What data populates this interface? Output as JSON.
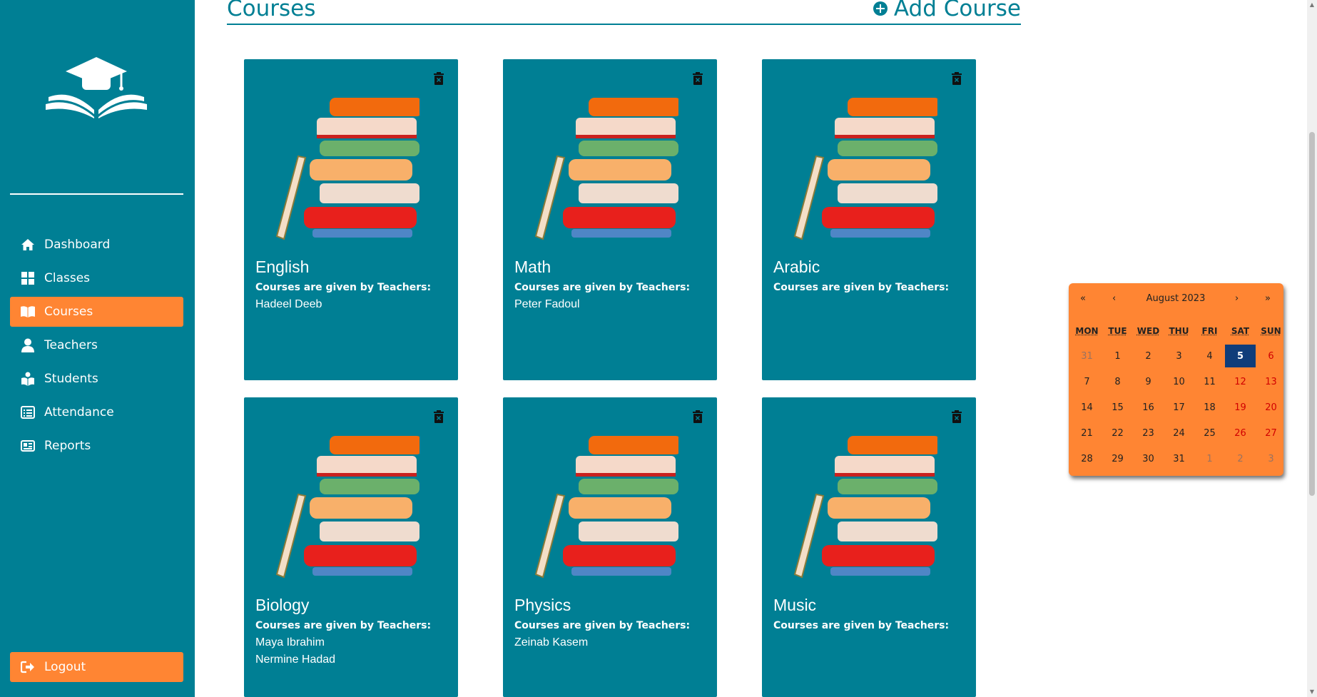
{
  "sidebar": {
    "logo": "graduation-cap-book-logo",
    "items": [
      {
        "label": "Dashboard",
        "icon": "home-icon"
      },
      {
        "label": "Classes",
        "icon": "grid-icon"
      },
      {
        "label": "Courses",
        "icon": "open-book-icon",
        "active": true
      },
      {
        "label": "Teachers",
        "icon": "person-icon"
      },
      {
        "label": "Students",
        "icon": "student-icon"
      },
      {
        "label": "Attendance",
        "icon": "list-icon"
      },
      {
        "label": "Reports",
        "icon": "report-card-icon"
      }
    ],
    "logout_label": "Logout"
  },
  "header": {
    "title": "Courses",
    "add_label": "Add Course"
  },
  "courses": [
    {
      "name": "English",
      "teachers_label": "Courses are given by Teachers:",
      "teachers": [
        "Hadeel Deeb"
      ]
    },
    {
      "name": "Math",
      "teachers_label": "Courses are given by Teachers:",
      "teachers": [
        "Peter Fadoul"
      ]
    },
    {
      "name": "Arabic",
      "teachers_label": "Courses are given by Teachers:",
      "teachers": []
    },
    {
      "name": "Biology",
      "teachers_label": "Courses are given by Teachers:",
      "teachers": [
        "Maya Ibrahim",
        "Nermine Hadad"
      ]
    },
    {
      "name": "Physics",
      "teachers_label": "Courses are given by Teachers:",
      "teachers": [
        "Zeinab Kasem"
      ]
    },
    {
      "name": "Music",
      "teachers_label": "Courses are given by Teachers:",
      "teachers": []
    }
  ],
  "calendar": {
    "month_label": "August 2023",
    "nav": {
      "prev_year": "«",
      "prev_month": "‹",
      "next_month": "›",
      "next_year": "»"
    },
    "weekdays": [
      "MON",
      "TUE",
      "WED",
      "THU",
      "FRI",
      "SAT",
      "SUN"
    ],
    "weeks": [
      [
        "31",
        "1",
        "2",
        "3",
        "4",
        "5",
        "6"
      ],
      [
        "7",
        "8",
        "9",
        "10",
        "11",
        "12",
        "13"
      ],
      [
        "14",
        "15",
        "16",
        "17",
        "18",
        "19",
        "20"
      ],
      [
        "21",
        "22",
        "23",
        "24",
        "25",
        "26",
        "27"
      ],
      [
        "28",
        "29",
        "30",
        "31",
        "1",
        "2",
        "3"
      ]
    ],
    "selected_day": "5"
  },
  "colors": {
    "primary": "#007f94",
    "accent": "#ff8533",
    "selected": "#0f3d7a",
    "weekend": "#d10000"
  }
}
